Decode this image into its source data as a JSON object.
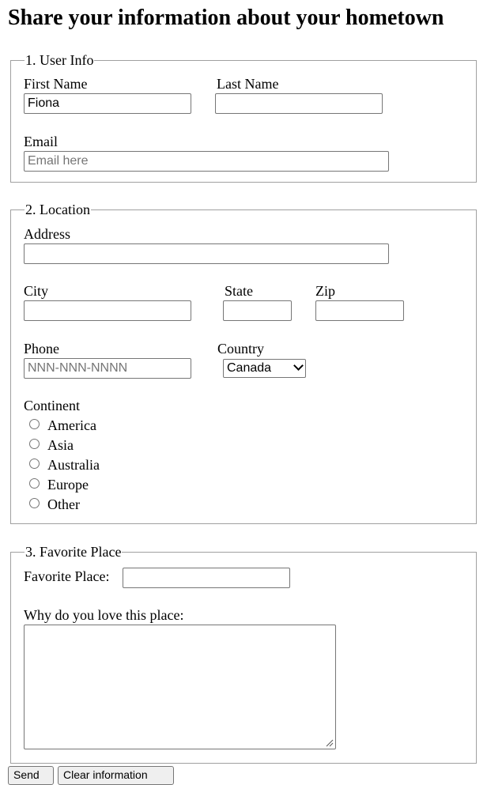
{
  "page": {
    "title": "Share your information about your hometown"
  },
  "user_info": {
    "legend": "1. User Info",
    "first_name_label": "First Name",
    "first_name_value": "Fiona",
    "last_name_label": "Last Name",
    "last_name_value": "",
    "email_label": "Email",
    "email_value": "",
    "email_placeholder": "Email here"
  },
  "location": {
    "legend": "2. Location",
    "address_label": "Address",
    "address_value": "",
    "city_label": "City",
    "state_label": "State",
    "zip_label": "Zip",
    "phone_label": "Phone",
    "phone_placeholder": "NNN-NNN-NNNN",
    "country_label": "Country",
    "country_selected": "Canada",
    "continent_label": "Continent",
    "continents": [
      "America",
      "Asia",
      "Australia",
      "Europe",
      "Other"
    ]
  },
  "favorite": {
    "legend": "3. Favorite Place",
    "place_label": "Favorite Place:",
    "place_value": "",
    "why_label": "Why do you love this place:",
    "why_value": ""
  },
  "buttons": {
    "send_label": "Send",
    "clear_label": "Clear information"
  }
}
